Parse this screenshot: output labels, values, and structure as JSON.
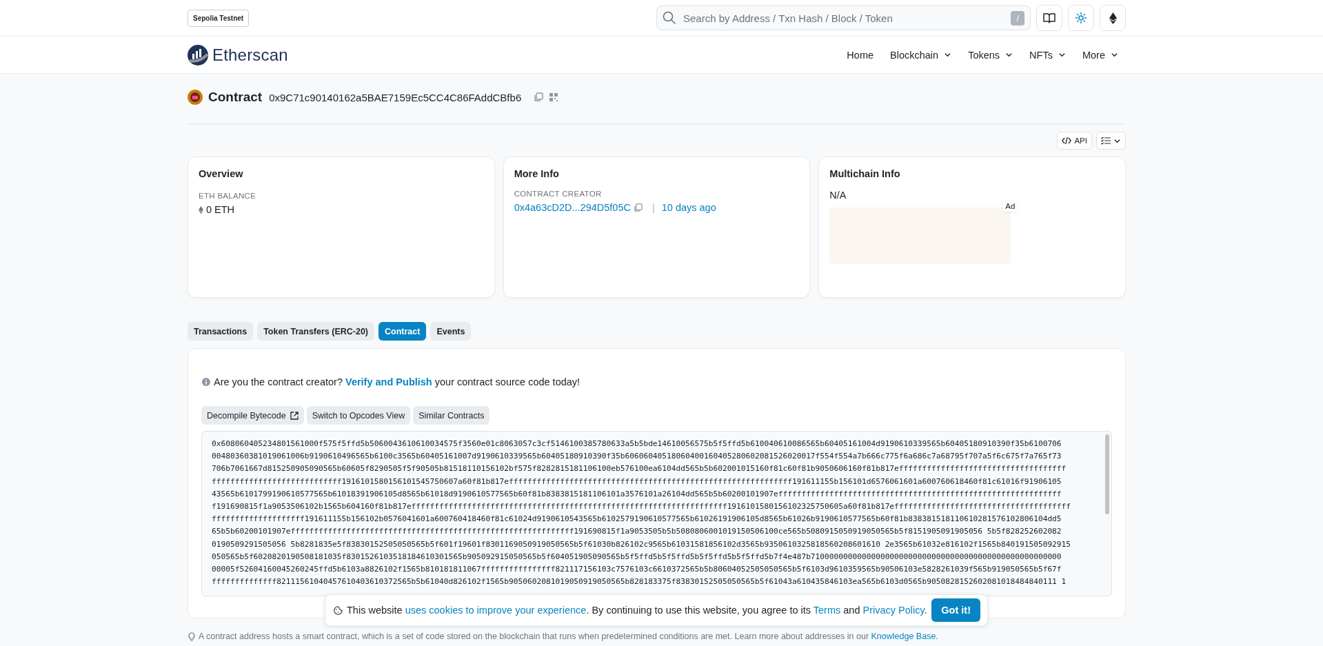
{
  "network_badge": "Sepolia Testnet",
  "search": {
    "placeholder": "Search by Address / Txn Hash / Block / Token",
    "shortcut": "/"
  },
  "brand": "Etherscan",
  "nav": [
    {
      "label": "Home",
      "dropdown": false
    },
    {
      "label": "Blockchain",
      "dropdown": true
    },
    {
      "label": "Tokens",
      "dropdown": true
    },
    {
      "label": "NFTs",
      "dropdown": true
    },
    {
      "label": "More",
      "dropdown": true
    }
  ],
  "page": {
    "title": "Contract",
    "address": "0x9C71c90140162a5BAE7159Ec5CC4C86FAddCBfb6"
  },
  "toolbar": {
    "api": "API"
  },
  "cards": [
    {
      "title": "Overview",
      "kind": "balance",
      "label": "ETH BALANCE",
      "value": "0 ETH"
    },
    {
      "title": "More Info",
      "kind": "creator",
      "label": "CONTRACT CREATOR",
      "creator": "0x4a63cD2D...294D5f05C",
      "separator": "|",
      "age": "10 days ago"
    },
    {
      "title": "Multichain Info",
      "kind": "multichain",
      "value": "N/A",
      "ad": "Ad"
    }
  ],
  "tabs": [
    {
      "label": "Transactions",
      "selected": false
    },
    {
      "label": "Token Transfers (ERC-20)",
      "selected": false
    },
    {
      "label": "Contract",
      "selected": true
    },
    {
      "label": "Events",
      "selected": false
    }
  ],
  "verify_notice": {
    "before": "Are you the contract creator?",
    "link": "Verify and Publish",
    "after": "your contract source code today!"
  },
  "code_buttons": [
    {
      "label": "Decompile Bytecode",
      "external": true
    },
    {
      "label": "Switch to Opcodes View",
      "external": false
    },
    {
      "label": "Similar Contracts",
      "external": false
    }
  ],
  "bytecode": [
    "0x608060405234801561000f575f5ffd5b5060043610610034575f3560e01c8063057c3cf5146100385780633a5b5bde14610056575b5f5ffd5b610040610086565b60405161004d9190610339565b60405180910390f35b6100706",
    "00480360381019061006b9190610496565b6100c3565b60405161007d9190610339565b60405180910390f35b60606040518060400160405280602081526020017f554f554a7b666c775f6a686c7a68795f707a5f6c675f7a765f73",
    "706b7061667d815250905090565b60605f8290505f5f90505b81518110156102bf575f8282815181106100eb576100ea6104dd565b5b602001015160f81c60f81b9050606160f81b817effffffffffffffffffffffffffffffffffff",
    "ffffffffffffffffffffffffffff1916101580156101545750607a60f81b817efffffffffffffffffffffffffffffffffffffffffffffffffffffffffffff191611155b156101d6576061601a600760618460f81c61016f91906105",
    "43565b6101799190610577565b61018391906105d8565b61018d9190610577565b60f81b8383815181106101a3576101a26104dd565b5b60200101907efffffffffffffffffffffffffffffffffffffffffffffffffffffffffffff",
    "f191690815f1a9053506102b1565b604160f81b817effffffffffffffffffffffffffffffffffffffffffffffffffffffffffffffffffff1916101580156102325750605a60f81b817effffffffffffffffffffffffffffffffffffff",
    "ffffffffffffffffffff191611155b156102b0576041601a600760418460f81c61024d9190610543565b6102579190610577565b61026191906105d8565b61026b9190610577565b60f81b838381518110610281576102806104dd5",
    "65b5b60200101907efffffffffffffffffffffffffffffffffffffffffffffffffffffffffffff191690815f1a9053505b5b5080806001019150506100ce565b5080915050919050565b5f8151905091905056 5b5f828252602082",
    "0190509291505056 5b8281835e5f83830152505050565b5f601f19601f8301169050919050565b5f61030b826102c9565b61031581856102d3565b9350610325818560208601610 2e3565b61032e816102f1565b840191505092915",
    "050565b5f6020820190508181035f8301526103518184610301565b905092915050565b5f604051905090565b5f5ffd5b5f5ffd5b5f5ffd5b5f5ffd5b7f4e487b710000000000000000000000000000000000000000000000000000",
    "00005f52604160045260245ffd5b6103a8826102f1565b810181811067ffffffffffffffff821117156103c7576103c6610372565b5b80604052505050565b5f6103d9610359565b90506103e5828261039f565b919050565b5f67f",
    "ffffffffffffff82111561040457610403610372565b5b61040d826102f1565b9050602081019050919050565b828183375f83830152505050565b5f61043a610435846103ea565b6103d0565b9050828152602081018484840111 1"
  ],
  "footer_note": {
    "text": "A contract address hosts a smart contract, which is a set of code stored on the blockchain that runs when predetermined conditions are met. Learn more about addresses in our",
    "link": "Knowledge Base",
    "end": "."
  },
  "cookie": {
    "before": "This website",
    "link1": "uses cookies to improve your experience",
    "middle": ". By continuing to use this website, you agree to its",
    "link2": "Terms",
    "and": "and",
    "link3": "Privacy Policy",
    "end": ".",
    "button": "Got it!"
  }
}
